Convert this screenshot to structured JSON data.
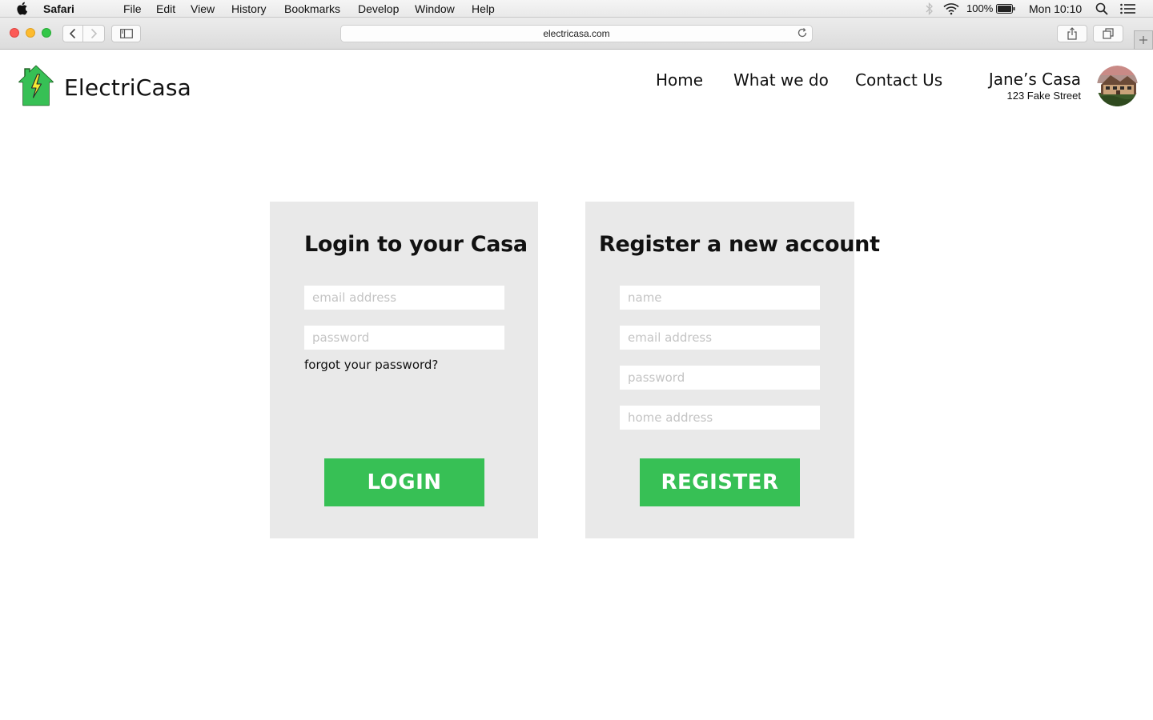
{
  "menubar": {
    "app_name": "Safari",
    "items": [
      "File",
      "Edit",
      "View",
      "History",
      "Bookmarks",
      "Develop",
      "Window",
      "Help"
    ],
    "battery": "100%",
    "clock": "Mon 10:10"
  },
  "browser": {
    "url": "electricasa.com"
  },
  "site": {
    "brand": "ElectriCasa",
    "nav": {
      "home": "Home",
      "what": "What we do",
      "contact": "Contact Us"
    },
    "account": {
      "name": "Jane’s Casa",
      "address": "123 Fake Street"
    },
    "colors": {
      "accent": "#37c055",
      "panel_bg": "#e9e9e9"
    }
  },
  "login": {
    "title": "Login to your Casa",
    "email_placeholder": "email address",
    "password_placeholder": "password",
    "forgot": "forgot your password?",
    "button": "LOGIN"
  },
  "register": {
    "title": "Register a new account",
    "name_placeholder": "name",
    "email_placeholder": "email address",
    "password_placeholder": "password",
    "address_placeholder": "home address",
    "button": "REGISTER"
  }
}
